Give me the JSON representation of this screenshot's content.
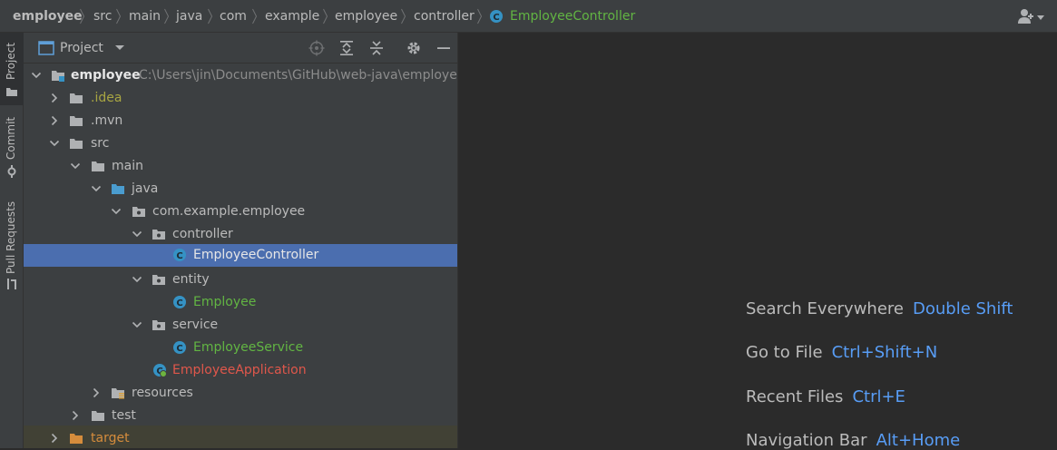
{
  "breadcrumb": {
    "items": [
      "employee",
      "src",
      "main",
      "java",
      "com",
      "example",
      "employee",
      "controller",
      "EmployeeController"
    ],
    "current_icon": "class-icon"
  },
  "stripe": {
    "tabs": [
      "Project",
      "Commit",
      "Pull Requests"
    ]
  },
  "panel": {
    "title": "Project"
  },
  "tree": {
    "root_name": "employee",
    "root_path": "C:\\Users\\jin\\Documents\\GitHub\\web-java\\employee",
    "items": [
      {
        "label": ".idea"
      },
      {
        "label": ".mvn"
      },
      {
        "label": "src"
      },
      {
        "label": "main"
      },
      {
        "label": "java"
      },
      {
        "label": "com.example.employee"
      },
      {
        "label": "controller"
      },
      {
        "label": "EmployeeController"
      },
      {
        "label": "entity"
      },
      {
        "label": "Employee"
      },
      {
        "label": "service"
      },
      {
        "label": "EmployeeService"
      },
      {
        "label": "EmployeeApplication"
      },
      {
        "label": "resources"
      },
      {
        "label": "test"
      },
      {
        "label": "target"
      }
    ],
    "class_icon_letter": "C"
  },
  "editor": {
    "hints": [
      {
        "name": "Search Everywhere",
        "key": "Double Shift"
      },
      {
        "name": "Go to File",
        "key": "Ctrl+Shift+N"
      },
      {
        "name": "Recent Files",
        "key": "Ctrl+E"
      },
      {
        "name": "Navigation Bar",
        "key": "Alt+Home"
      }
    ]
  },
  "colors": {
    "background": "#2b2b2b",
    "panel": "#3c3f41",
    "selection": "#4b6eaf",
    "class_icon": "#3592c4",
    "shortcut": "#589df6",
    "vcs_green": "#62b543",
    "vcs_yellow": "#a8a542",
    "vcs_red": "#e0574b",
    "excluded_orange": "#d58c3c"
  }
}
